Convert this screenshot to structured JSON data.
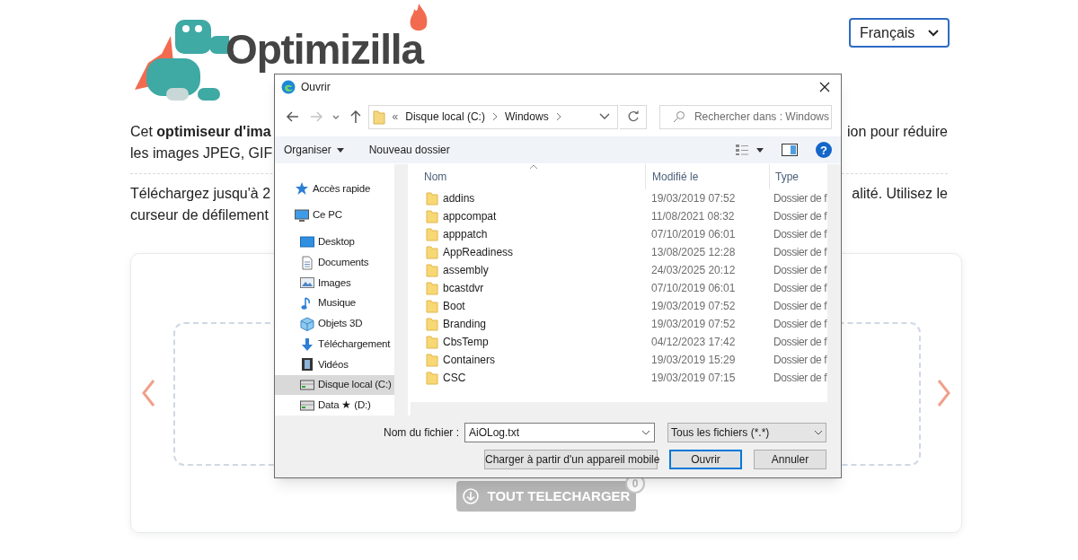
{
  "language_select": {
    "value": "Français"
  },
  "logo": {
    "text": "Optimizilla"
  },
  "intro": [
    {
      "left": "Cet **optimiseur d'ima**",
      "right": "ion pour réduire"
    },
    {
      "left": "les images JPEG, GIF"
    }
  ],
  "upload_intro": [
    {
      "left": "Téléchargez jusqu'à 2",
      "right": "alité. Utilisez le"
    },
    {
      "left": "curseur de défilement"
    }
  ],
  "download_all": {
    "label": "TOUT TELECHARGER",
    "count": "0",
    "disabled": true
  },
  "dialog": {
    "title": "Ouvrir",
    "breadcrumb_prefix": "«",
    "breadcrumb": [
      "Disque local (C:)",
      "Windows"
    ],
    "search": {
      "placeholder": "Rechercher dans : Windows"
    },
    "toolbar": [
      {
        "label": "Organiser",
        "dropdown": true
      },
      {
        "label": "Nouveau dossier",
        "dropdown": false
      }
    ],
    "help": "?",
    "nav": [
      {
        "label": "Accès rapide",
        "kind": "star",
        "selected": false
      },
      {
        "label": "Ce PC",
        "kind": "pc",
        "selected": false,
        "children": [
          {
            "label": "Desktop",
            "kind": "desktop",
            "selected": false
          },
          {
            "label": "Documents",
            "kind": "document",
            "selected": false
          },
          {
            "label": "Images",
            "kind": "image",
            "selected": false
          },
          {
            "label": "Musique",
            "kind": "music",
            "selected": false
          },
          {
            "label": "Objets 3D",
            "kind": "cube",
            "selected": false
          },
          {
            "label": "Téléchargement",
            "kind": "download",
            "selected": false
          },
          {
            "label": "Vidéos",
            "kind": "video",
            "selected": false
          },
          {
            "label": "Disque local (C:)",
            "kind": "drive",
            "selected": true
          },
          {
            "label": "Data ★ (D:)",
            "kind": "drive",
            "selected": false
          }
        ]
      }
    ],
    "columns": [
      "Nom",
      "Modifié le",
      "Type"
    ],
    "rows": [
      {
        "name": "addins",
        "modified": "19/03/2019 07:52",
        "type": "Dossier de f"
      },
      {
        "name": "appcompat",
        "modified": "11/08/2021 08:32",
        "type": "Dossier de f"
      },
      {
        "name": "apppatch",
        "modified": "07/10/2019 06:01",
        "type": "Dossier de f"
      },
      {
        "name": "AppReadiness",
        "modified": "13/08/2025 12:28",
        "type": "Dossier de f"
      },
      {
        "name": "assembly",
        "modified": "24/03/2025 20:12",
        "type": "Dossier de f"
      },
      {
        "name": "bcastdvr",
        "modified": "07/10/2019 06:01",
        "type": "Dossier de f"
      },
      {
        "name": "Boot",
        "modified": "19/03/2019 07:52",
        "type": "Dossier de f"
      },
      {
        "name": "Branding",
        "modified": "19/03/2019 07:52",
        "type": "Dossier de f"
      },
      {
        "name": "CbsTemp",
        "modified": "04/12/2023 17:42",
        "type": "Dossier de f"
      },
      {
        "name": "Containers",
        "modified": "19/03/2019 15:29",
        "type": "Dossier de f"
      },
      {
        "name": "CSC",
        "modified": "19/03/2019 07:15",
        "type": "Dossier de f"
      }
    ],
    "filename_label": "Nom du fichier :",
    "filename": "AiOLog.txt",
    "filter": "Tous les fichiers (*.*)",
    "buttons": [
      {
        "label": "Charger à partir d'un appareil mobile",
        "default": false
      },
      {
        "label": "Ouvrir",
        "default": true
      },
      {
        "label": "Annuler",
        "default": false
      }
    ]
  }
}
